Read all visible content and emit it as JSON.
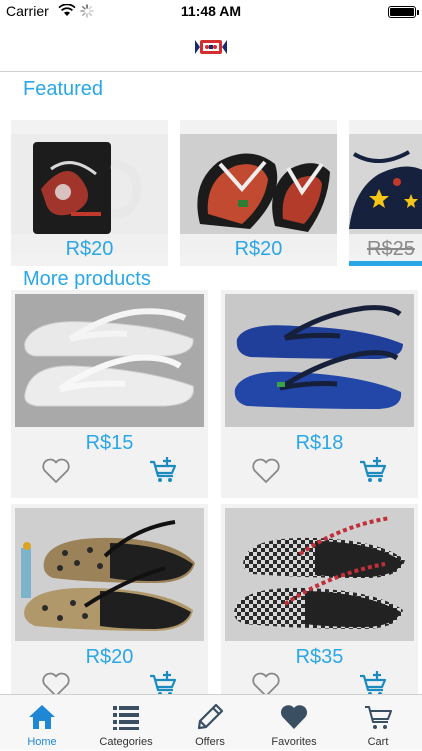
{
  "status_bar": {
    "carrier": "Carrier",
    "time": "11:48 AM"
  },
  "sections": {
    "featured_title": "Featured",
    "more_title": "More products"
  },
  "featured": [
    {
      "price": "R$20",
      "image": "black-mug"
    },
    {
      "price": "R$20",
      "image": "printed-flip-flops"
    },
    {
      "price": "R$25",
      "image": "star-flip-flops",
      "strikethrough": true
    }
  ],
  "products": [
    {
      "price": "R$15",
      "image": "white-flip-flops"
    },
    {
      "price": "R$18",
      "image": "blue-flip-flops"
    },
    {
      "price": "R$20",
      "image": "glitter-polka-flip-flops"
    },
    {
      "price": "R$35",
      "image": "checkered-flip-flops"
    }
  ],
  "tabs": [
    {
      "label": "Home",
      "icon": "home-icon",
      "active": true
    },
    {
      "label": "Categories",
      "icon": "list-icon"
    },
    {
      "label": "Offers",
      "icon": "tag-icon"
    },
    {
      "label": "Favorites",
      "icon": "heart-icon"
    },
    {
      "label": "Cart",
      "icon": "cart-icon"
    }
  ],
  "colors": {
    "accent": "#2aa7e6",
    "tab_active": "#1e88d4",
    "card_bg": "#f2f2f2"
  }
}
